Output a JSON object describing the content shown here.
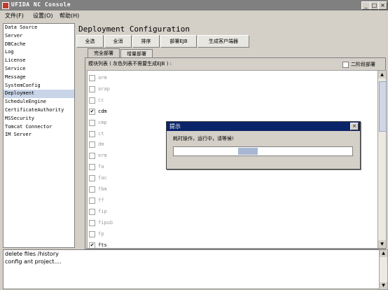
{
  "window": {
    "title": "UFIDA NC Console",
    "minimize": "_",
    "maximize": "□",
    "close": "×"
  },
  "menu": [
    "文件(F)",
    "设置(O)",
    "帮助(H)"
  ],
  "sidebar": {
    "items": [
      {
        "label": "Data Source"
      },
      {
        "label": "Server"
      },
      {
        "label": "DBCache"
      },
      {
        "label": "Log"
      },
      {
        "label": "License"
      },
      {
        "label": "Service"
      },
      {
        "label": "Message"
      },
      {
        "label": "SystemConfig"
      },
      {
        "label": "Deployment",
        "selected": true
      },
      {
        "label": "ScheduleEngine"
      },
      {
        "label": "CertificateAuthority"
      },
      {
        "label": "MSSecurity"
      },
      {
        "label": "Tomcat Connector"
      },
      {
        "label": "IM Server"
      }
    ]
  },
  "main": {
    "heading": "Deployment Configuration",
    "toolbar": [
      "全选",
      "全消",
      "排序",
      "部署EJB",
      "生成客户端器"
    ],
    "tabs": [
      {
        "label": "完全部署",
        "active": true
      },
      {
        "label": "增量部署",
        "active": false
      }
    ],
    "list_caption": "模块列表 ( 灰色列表不需要生成EJB ) :",
    "two_stage_label": "二阶段部署",
    "modules": [
      {
        "name": "arm",
        "checked": false
      },
      {
        "name": "arap",
        "checked": false
      },
      {
        "name": "cc",
        "checked": false
      },
      {
        "name": "cdm",
        "checked": true
      },
      {
        "name": "cmp",
        "checked": false
      },
      {
        "name": "ct",
        "checked": false
      },
      {
        "name": "dm",
        "checked": false
      },
      {
        "name": "erm",
        "checked": false
      },
      {
        "name": "fa",
        "checked": false
      },
      {
        "name": "fac",
        "checked": false
      },
      {
        "name": "fbm",
        "checked": false
      },
      {
        "name": "ff",
        "checked": false
      },
      {
        "name": "fip",
        "checked": false
      },
      {
        "name": "fipub",
        "checked": false
      },
      {
        "name": "fp",
        "checked": false
      },
      {
        "name": "fts",
        "checked": true
      }
    ],
    "scroll_up": "▲",
    "scroll_down": "▼"
  },
  "dialog": {
    "title": "提示",
    "close": "×",
    "message": "耗时操作，运行中，请等候!",
    "progress_start": 0.36,
    "progress_end": 0.47
  },
  "console": {
    "lines": [
      "delete files /history",
      "config ant project...."
    ],
    "scroll_up": "▲",
    "scroll_down": "▼"
  }
}
